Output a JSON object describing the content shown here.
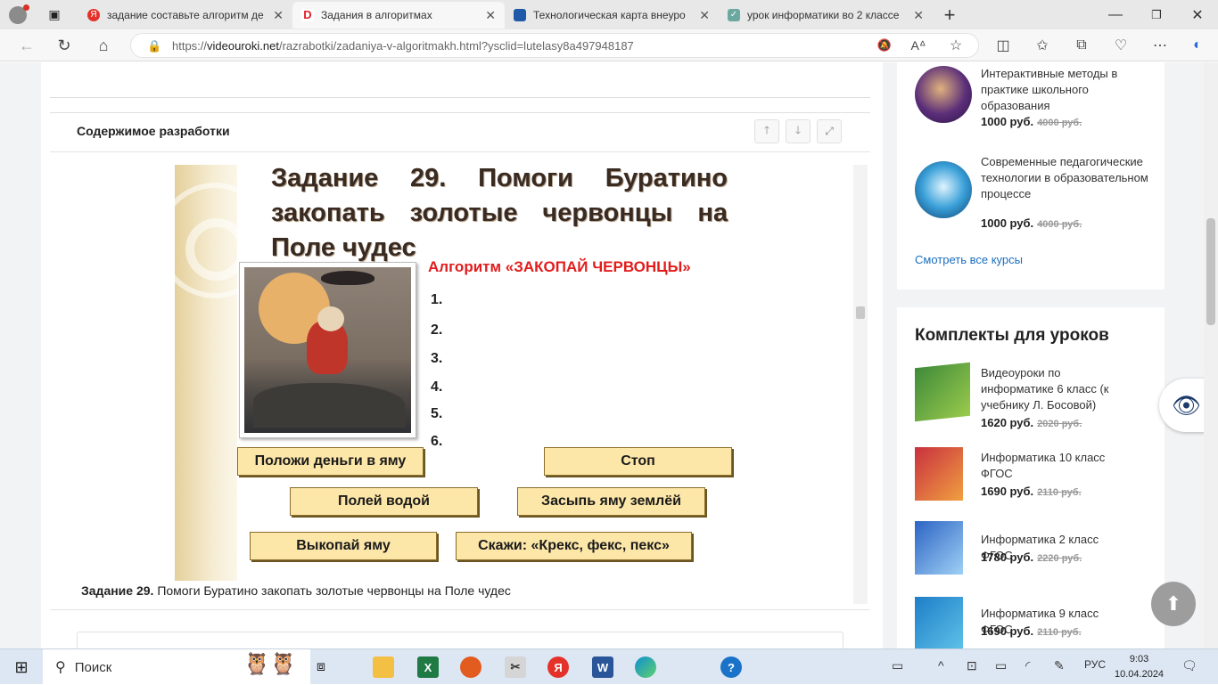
{
  "browser": {
    "tabs": [
      {
        "title": "задание составьте алгоритм де",
        "favicon_color": "#e4322b",
        "favicon_letter": "Я",
        "active": false
      },
      {
        "title": "Задания в алгоритмах",
        "favicon_color": "#e0202c",
        "favicon_letter": "D",
        "active": true
      },
      {
        "title": "Технологическая карта внеуро",
        "favicon_color": "#1e5aa8",
        "favicon_letter": "",
        "active": false
      },
      {
        "title": "урок информатики во 2 классе",
        "favicon_color": "#6aa8a0",
        "favicon_letter": "✓",
        "active": false
      }
    ],
    "url_prefix": "https://",
    "url_domain": "videouroki.net",
    "url_path": "/razrabotki/zadaniya-v-algoritmakh.html?ysclid=lutelasy8a497948187"
  },
  "content": {
    "section_title": "Содержимое разработки",
    "slide": {
      "heading": "Задание 29. Помоги Буратино закопать золотые червонцы на Поле чудес",
      "algorithm_title": "Алгоритм «ЗАКОПАЙ ЧЕРВОНЦЫ»",
      "steps": [
        "1.",
        "2.",
        "3.",
        "4.",
        "5.",
        "6."
      ],
      "cards": [
        "Положи деньги в яму",
        "Стоп",
        "Полей водой",
        "Засыпь яму землёй",
        "Выкопай яму",
        "Скажи: «Крекс, фекс, пекс»"
      ]
    },
    "caption_bold": "Задание 29.",
    "caption_text": " Помоги Буратино закопать золотые червонцы на Поле чудес"
  },
  "sidebar": {
    "courses": [
      {
        "title": "Интерактивные методы в практике школьного образования",
        "price": "1000 руб.",
        "old_price": "4000 руб."
      },
      {
        "title": "Современные педагогические технологии в образовательном процессе",
        "price": "1000 руб.",
        "old_price": "4000 руб."
      }
    ],
    "all_courses_link": "Смотреть все курсы",
    "kits_title": "Комплекты для уроков",
    "kits": [
      {
        "title": "Видеоуроки по информатике 6 класс (к учебнику Л. Босовой)",
        "price": "1620 руб.",
        "old_price": "2020 руб."
      },
      {
        "title": "Информатика 10 класс ФГОС",
        "price": "1690 руб.",
        "old_price": "2110 руб."
      },
      {
        "title": "Информатика 2 класс ФГОС",
        "price": "1780 руб.",
        "old_price": "2220 руб."
      },
      {
        "title": "Информатика 9 класс ФГОС",
        "price": "1690 руб.",
        "old_price": "2110 руб."
      }
    ]
  },
  "taskbar": {
    "search_placeholder": "Поиск",
    "language": "РУС",
    "time": "9:03",
    "date": "10.04.2024"
  }
}
